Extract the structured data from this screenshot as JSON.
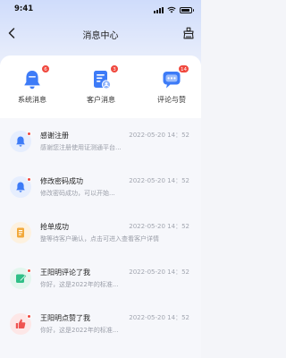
{
  "status_bar": {
    "time": "9:41",
    "battery_level": 0.85
  },
  "nav": {
    "title": "消息中心",
    "back_icon": "chevron-left-icon",
    "clean_icon": "broom-icon"
  },
  "categories": [
    {
      "id": "system",
      "label": "系统消息",
      "badge": "6",
      "icon": "bell-icon",
      "color": "#3d7bf7"
    },
    {
      "id": "customer",
      "label": "客户消息",
      "badge": "3",
      "icon": "customer-card-icon",
      "color": "#3d7bf7"
    },
    {
      "id": "comments",
      "label": "评论与赞",
      "badge": "14",
      "icon": "chat-icon",
      "color": "#3d7bf7"
    }
  ],
  "messages": [
    {
      "title": "感谢注册",
      "time": "2022-05-20 14：52",
      "text": "感谢您注册使用证测通平台...",
      "icon": "bell-icon",
      "icon_bg": "#e6eefe",
      "icon_color": "#3d7bf7",
      "unread": true
    },
    {
      "title": "修改密码成功",
      "time": "2022-05-20 14：52",
      "text": "修改密码成功，可以开始...",
      "icon": "bell-icon",
      "icon_bg": "#e6eefe",
      "icon_color": "#3d7bf7",
      "unread": true
    },
    {
      "title": "抢单成功",
      "time": "2022-05-20 14：52",
      "text": "整等待客户确认，点击可进入查看客户详情",
      "icon": "document-icon",
      "icon_bg": "#fdf1df",
      "icon_color": "#f2a93b",
      "unread": false
    },
    {
      "title": "王阳明评论了我",
      "time": "2022-05-20 14：52",
      "text": "你好，这是2022年的标准...",
      "icon": "edit-icon",
      "icon_bg": "#e3f6ee",
      "icon_color": "#2fbf87",
      "unread": true
    },
    {
      "title": "王阳明点赞了我",
      "time": "2022-05-20 14：52",
      "text": "你好，这是2022年的标准...",
      "icon": "thumbs-up-icon",
      "icon_bg": "#fde7e7",
      "icon_color": "#ef5350",
      "unread": true
    }
  ]
}
